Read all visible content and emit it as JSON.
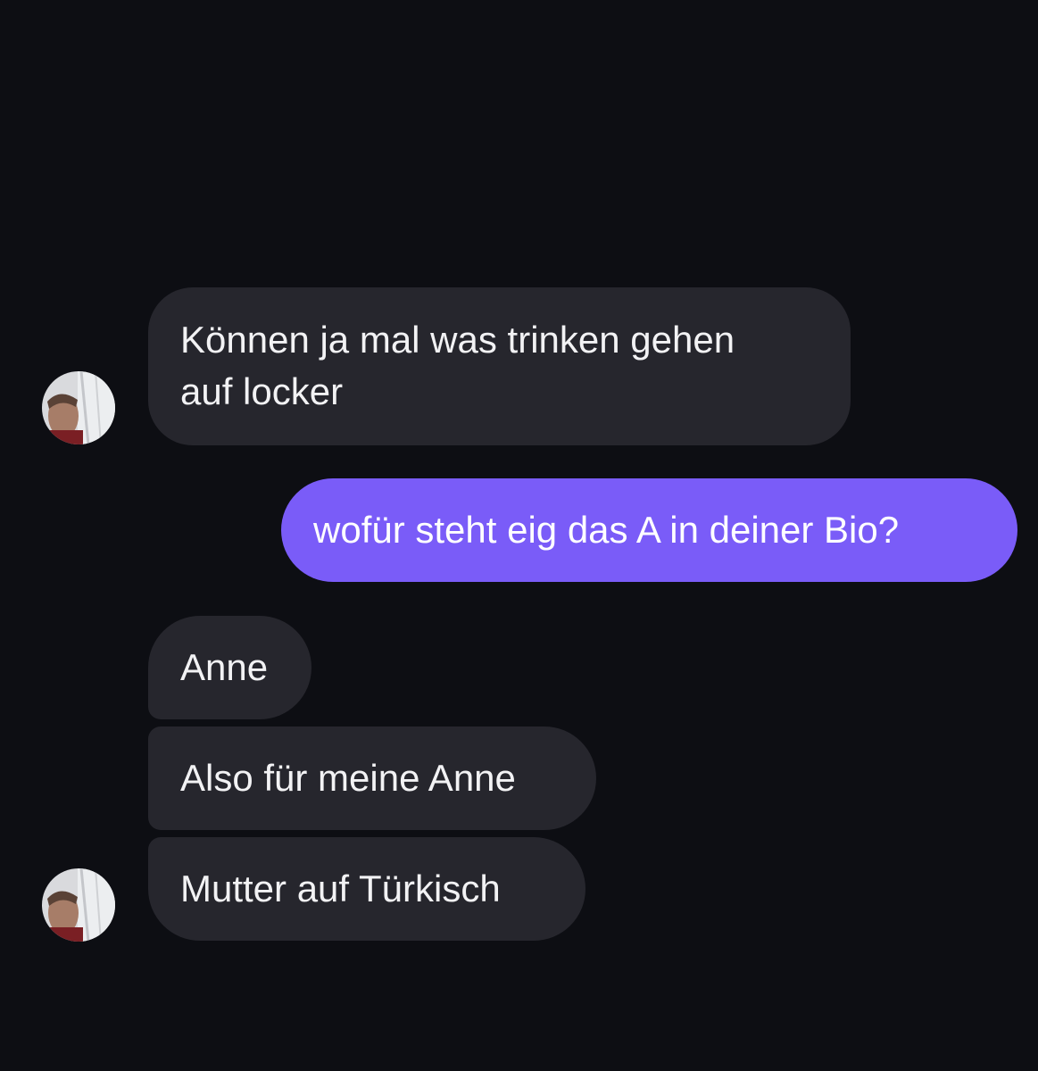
{
  "colors": {
    "background": "#0d0e13",
    "incoming_bubble": "#26262d",
    "outgoing_bubble": "#7a5cf8",
    "text": "#f2f2f4"
  },
  "messages": [
    {
      "direction": "incoming",
      "lines": [
        "Können ja mal was trinken gehen",
        "auf locker"
      ]
    },
    {
      "direction": "outgoing",
      "lines": [
        "wofür steht eig das A in deiner Bio?"
      ]
    },
    {
      "direction": "incoming",
      "lines": [
        "Anne"
      ]
    },
    {
      "direction": "incoming",
      "lines": [
        "Also für meine Anne"
      ]
    },
    {
      "direction": "incoming",
      "lines": [
        "Mutter auf Türkisch"
      ]
    }
  ],
  "avatars": [
    {
      "icon": "contact-avatar-photo"
    },
    {
      "icon": "contact-avatar-photo"
    }
  ]
}
